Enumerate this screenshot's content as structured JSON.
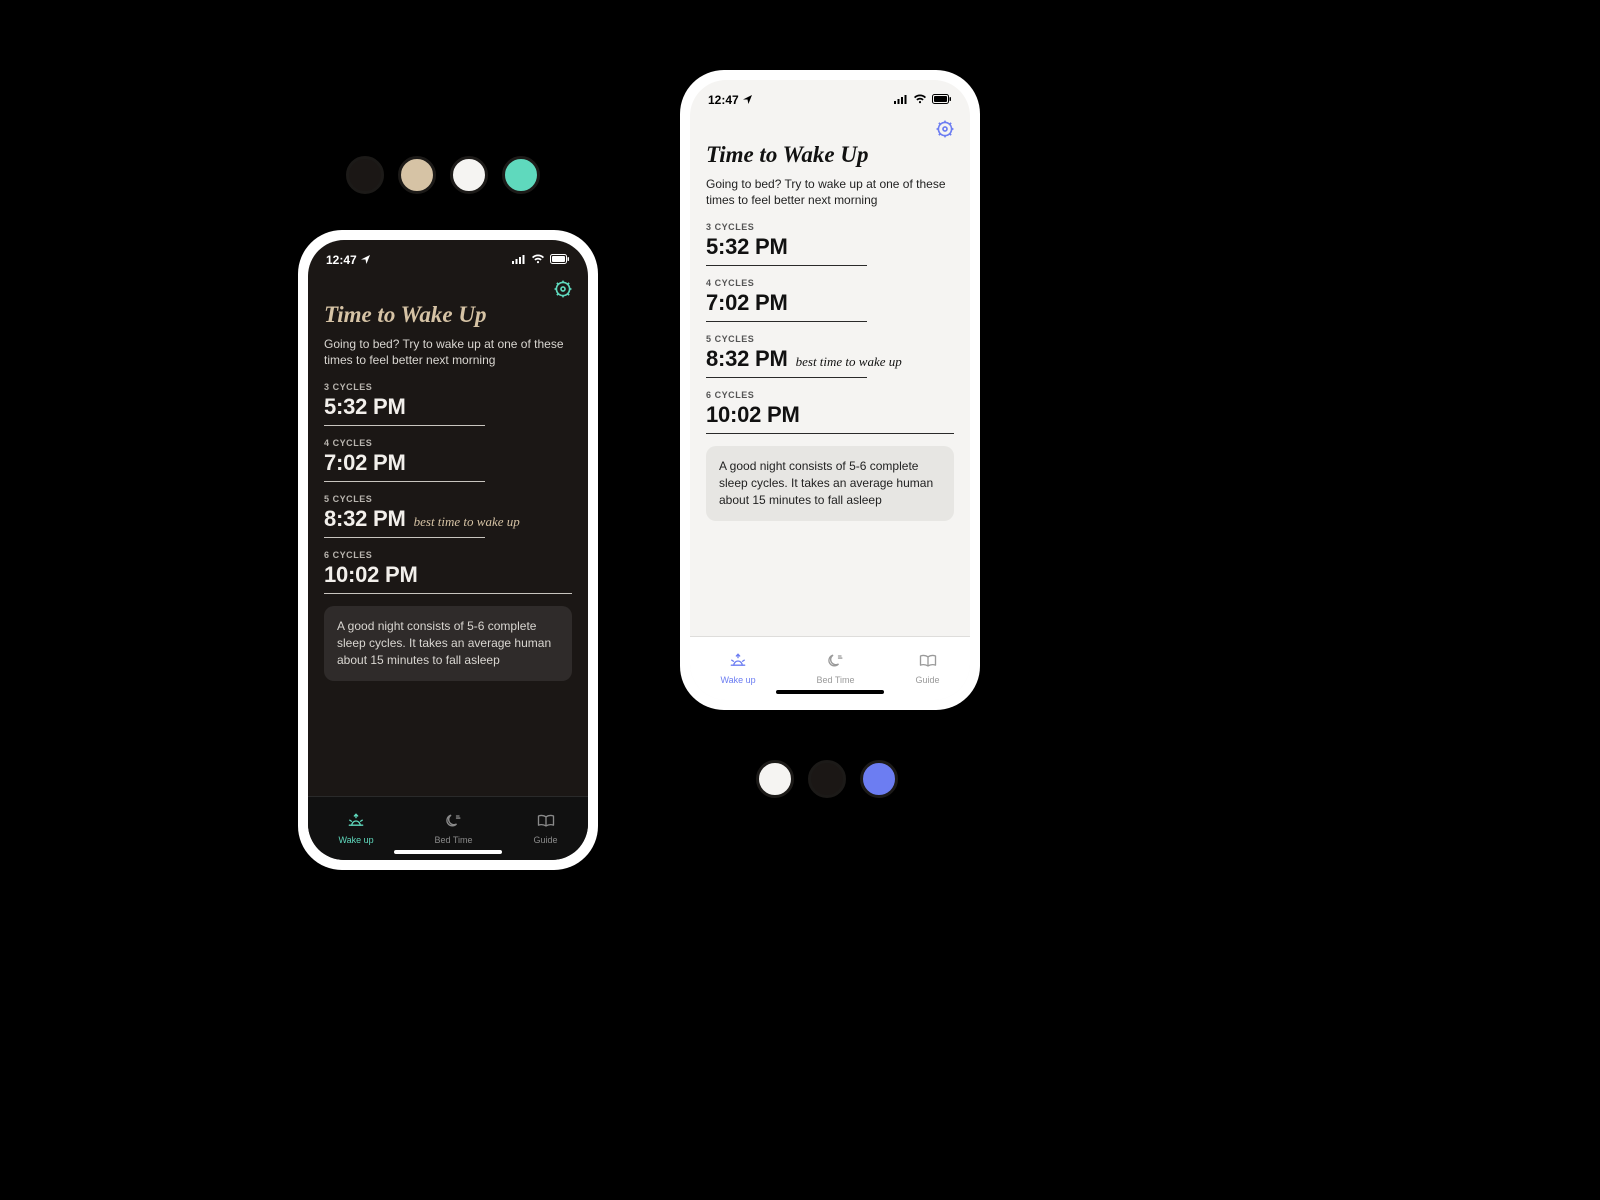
{
  "status": {
    "time": "12:47"
  },
  "page": {
    "title": "Time to Wake Up",
    "subtitle": "Going to bed? Try to wake up at one of these times to feel better next morning",
    "tip": "A good night consists of 5-6 complete sleep cycles. It takes an average human about 15 minutes to fall asleep"
  },
  "cycles": [
    {
      "label": "3 CYCLES",
      "time": "5:32 PM",
      "note": ""
    },
    {
      "label": "4 CYCLES",
      "time": "7:02 PM",
      "note": ""
    },
    {
      "label": "5 CYCLES",
      "time": "8:32 PM",
      "note": "best time to wake up"
    },
    {
      "label": "6 CYCLES",
      "time": "10:02 PM",
      "note": ""
    }
  ],
  "tabs": [
    {
      "label": "Wake up"
    },
    {
      "label": "Bed Time"
    },
    {
      "label": "Guide"
    }
  ],
  "palette_dark": [
    "#1b1715",
    "#d6c3a5",
    "#f5f4f2",
    "#5fd9bd"
  ],
  "palette_light": [
    "#f5f4f2",
    "#1b1715",
    "#6c7df2"
  ],
  "accents": {
    "dark_accent": "#5fd9bd",
    "light_accent": "#6c7df2"
  }
}
